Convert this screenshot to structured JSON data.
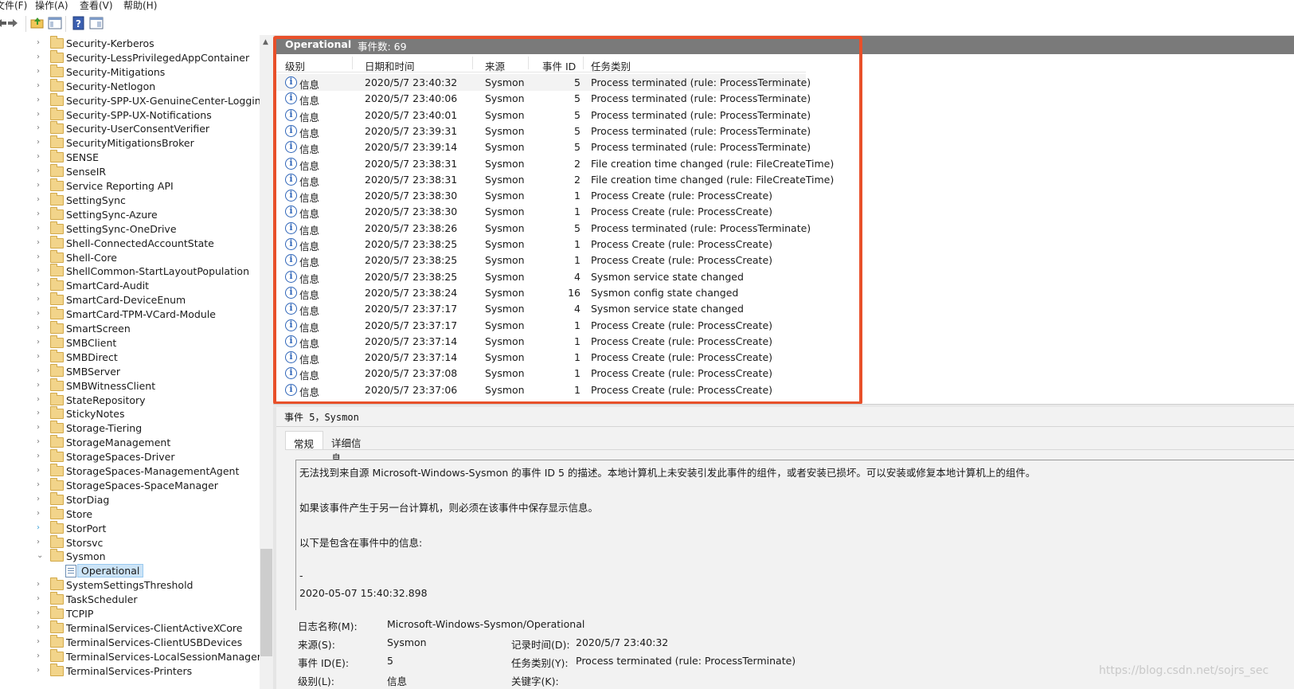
{
  "menu": [
    "文件(F)",
    "操作(A)",
    "查看(V)",
    "帮助(H)"
  ],
  "toolbar": {
    "icons": [
      "back-arrow-icon",
      "forward-arrow-icon",
      "up-folder-icon",
      "show-hide-tree-icon",
      "help-icon",
      "action-pane-icon"
    ]
  },
  "tree": {
    "items": [
      "Security-Kerberos",
      "Security-LessPrivilegedAppContainer",
      "Security-Mitigations",
      "Security-Netlogon",
      "Security-SPP-UX-GenuineCenter-Logging",
      "Security-SPP-UX-Notifications",
      "Security-UserConsentVerifier",
      "SecurityMitigationsBroker",
      "SENSE",
      "SenseIR",
      "Service Reporting API",
      "SettingSync",
      "SettingSync-Azure",
      "SettingSync-OneDrive",
      "Shell-ConnectedAccountState",
      "Shell-Core",
      "ShellCommon-StartLayoutPopulation",
      "SmartCard-Audit",
      "SmartCard-DeviceEnum",
      "SmartCard-TPM-VCard-Module",
      "SmartScreen",
      "SMBClient",
      "SMBDirect",
      "SMBServer",
      "SMBWitnessClient",
      "StateRepository",
      "StickyNotes",
      "Storage-Tiering",
      "StorageManagement",
      "StorageSpaces-Driver",
      "StorageSpaces-ManagementAgent",
      "StorageSpaces-SpaceManager",
      "StorDiag",
      "Store",
      "StorPort",
      "Storsvc",
      "Sysmon",
      "Operational",
      "SystemSettingsThreshold",
      "TaskScheduler",
      "TCPIP",
      "TerminalServices-ClientActiveXCore",
      "TerminalServices-ClientUSBDevices",
      "TerminalServices-LocalSessionManager",
      "TerminalServices-Printers"
    ]
  },
  "list": {
    "title": "Operational",
    "count": "事件数: 69",
    "columns": [
      "级别",
      "日期和时间",
      "来源",
      "事件 ID",
      "任务类别"
    ],
    "rows": [
      [
        "信息",
        "2020/5/7 23:40:32",
        "Sysmon",
        "5",
        "Process terminated (rule: ProcessTerminate)"
      ],
      [
        "信息",
        "2020/5/7 23:40:06",
        "Sysmon",
        "5",
        "Process terminated (rule: ProcessTerminate)"
      ],
      [
        "信息",
        "2020/5/7 23:40:01",
        "Sysmon",
        "5",
        "Process terminated (rule: ProcessTerminate)"
      ],
      [
        "信息",
        "2020/5/7 23:39:31",
        "Sysmon",
        "5",
        "Process terminated (rule: ProcessTerminate)"
      ],
      [
        "信息",
        "2020/5/7 23:39:14",
        "Sysmon",
        "5",
        "Process terminated (rule: ProcessTerminate)"
      ],
      [
        "信息",
        "2020/5/7 23:38:31",
        "Sysmon",
        "2",
        "File creation time changed (rule: FileCreateTime)"
      ],
      [
        "信息",
        "2020/5/7 23:38:31",
        "Sysmon",
        "2",
        "File creation time changed (rule: FileCreateTime)"
      ],
      [
        "信息",
        "2020/5/7 23:38:30",
        "Sysmon",
        "1",
        "Process Create (rule: ProcessCreate)"
      ],
      [
        "信息",
        "2020/5/7 23:38:30",
        "Sysmon",
        "1",
        "Process Create (rule: ProcessCreate)"
      ],
      [
        "信息",
        "2020/5/7 23:38:26",
        "Sysmon",
        "5",
        "Process terminated (rule: ProcessTerminate)"
      ],
      [
        "信息",
        "2020/5/7 23:38:25",
        "Sysmon",
        "1",
        "Process Create (rule: ProcessCreate)"
      ],
      [
        "信息",
        "2020/5/7 23:38:25",
        "Sysmon",
        "1",
        "Process Create (rule: ProcessCreate)"
      ],
      [
        "信息",
        "2020/5/7 23:38:25",
        "Sysmon",
        "4",
        "Sysmon service state changed"
      ],
      [
        "信息",
        "2020/5/7 23:38:24",
        "Sysmon",
        "16",
        "Sysmon config state changed"
      ],
      [
        "信息",
        "2020/5/7 23:37:17",
        "Sysmon",
        "4",
        "Sysmon service state changed"
      ],
      [
        "信息",
        "2020/5/7 23:37:17",
        "Sysmon",
        "1",
        "Process Create (rule: ProcessCreate)"
      ],
      [
        "信息",
        "2020/5/7 23:37:14",
        "Sysmon",
        "1",
        "Process Create (rule: ProcessCreate)"
      ],
      [
        "信息",
        "2020/5/7 23:37:14",
        "Sysmon",
        "1",
        "Process Create (rule: ProcessCreate)"
      ],
      [
        "信息",
        "2020/5/7 23:37:08",
        "Sysmon",
        "1",
        "Process Create (rule: ProcessCreate)"
      ],
      [
        "信息",
        "2020/5/7 23:37:06",
        "Sysmon",
        "1",
        "Process Create (rule: ProcessCreate)"
      ]
    ]
  },
  "details": {
    "title": "事件 5，Sysmon",
    "tabs": [
      "常规",
      "详细信息"
    ],
    "desc": [
      "无法找到来自源 Microsoft-Windows-Sysmon 的事件 ID 5 的描述。本地计算机上未安装引发此事件的组件，或者安装已损坏。可以安装或修复本地计算机上的组件。",
      "如果该事件产生于另一台计算机，则必须在该事件中保存显示信息。",
      "以下是包含在事件中的信息:",
      "-",
      "2020-05-07 15:40:32.898"
    ],
    "log_name_label": "日志名称(M):",
    "log_name": "Microsoft-Windows-Sysmon/Operational",
    "source_label": "来源(S):",
    "source": "Sysmon",
    "logged_label": "记录时间(D):",
    "logged": "2020/5/7 23:40:32",
    "event_id_label": "事件 ID(E):",
    "event_id": "5",
    "task_label": "任务类别(Y):",
    "task": "Process terminated (rule: ProcessTerminate)",
    "level_label": "级别(L):",
    "level": "信息",
    "keywords_label": "关键字(K):"
  },
  "watermark": "https://blog.csdn.net/sojrs_sec",
  "colors": {
    "highlight": "#e8502a",
    "header_bg": "#7a7a7a",
    "info_blue": "#2f65b8"
  }
}
